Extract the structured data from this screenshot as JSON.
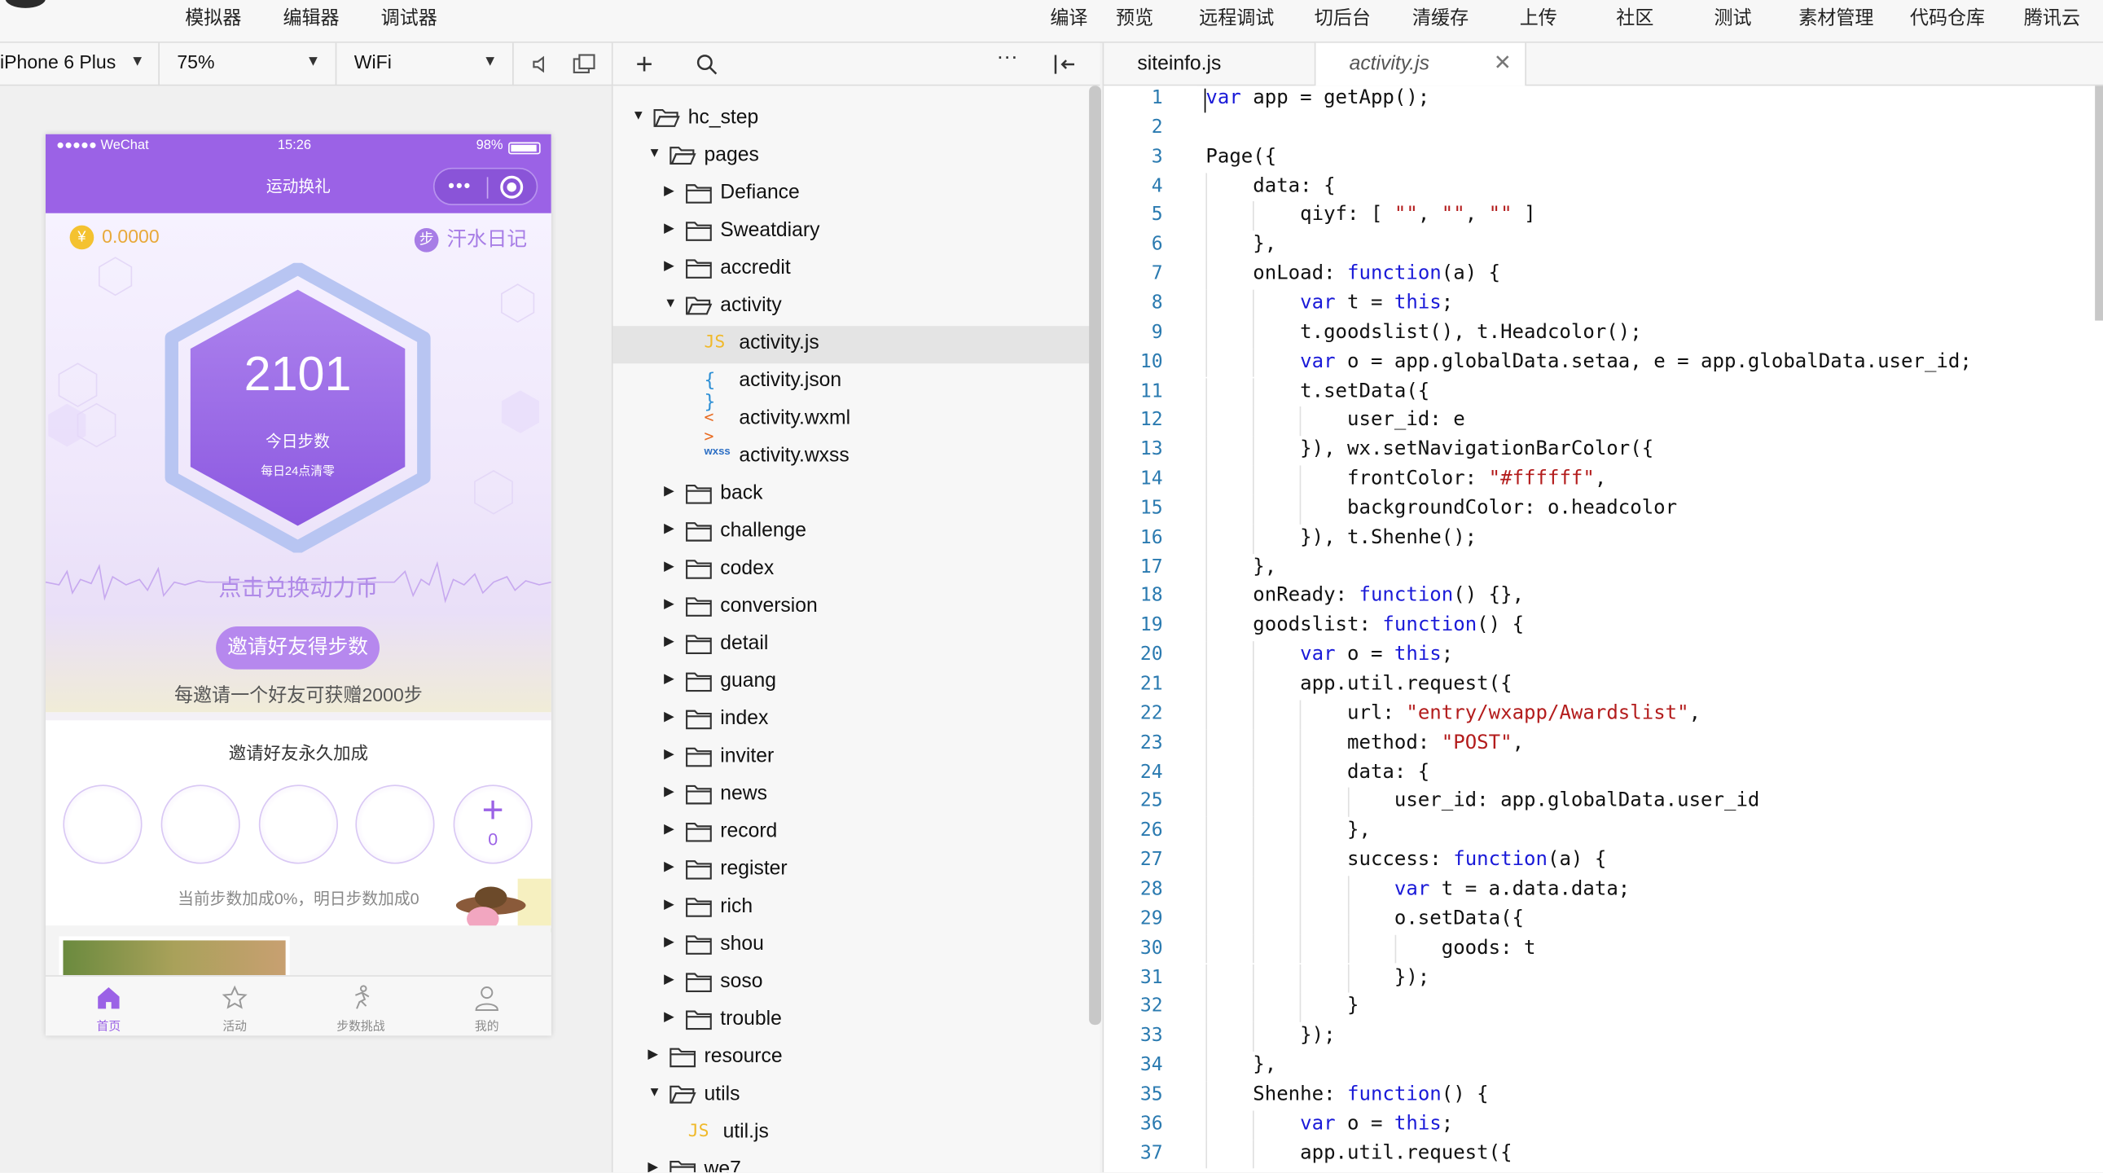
{
  "menu": {
    "left": [
      "模拟器",
      "编辑器",
      "调试器"
    ],
    "right": [
      "编译",
      "预览",
      "远程调试",
      "切后台",
      "清缓存",
      "上传",
      "社区",
      "测试",
      "素材管理",
      "代码仓库",
      "腾讯云"
    ]
  },
  "device": {
    "model": "iPhone 6 Plus",
    "zoom": "75%",
    "network": "WiFi"
  },
  "phone": {
    "carrier": "●●●●● WeChat",
    "time": "15:26",
    "battery": "98%",
    "nav_title": "运动换礼",
    "capsule_dots": "•••",
    "coin_symbol": "¥",
    "coin_value": "0.0000",
    "sweat_symbol": "步",
    "sweat_label": "汗水日记",
    "steps": "2101",
    "steps_label": "今日步数",
    "reset_note": "每日24点清零",
    "exchange": "点击兑换动力币",
    "invite_button": "邀请好友得步数",
    "invite_hint": "每邀请一个好友可获赠2000步",
    "bonus_title": "邀请好友永久加成",
    "add_symbol": "+",
    "invite_count": "0",
    "bonus_info": "当前步数加成0%，明日步数加成0",
    "tabs": [
      {
        "label": "首页",
        "icon": "home-icon"
      },
      {
        "label": "活动",
        "icon": "star-icon"
      },
      {
        "label": "步数挑战",
        "icon": "running-icon"
      },
      {
        "label": "我的",
        "icon": "user-icon"
      }
    ],
    "accent": "#9b62e6"
  },
  "tree": {
    "items": [
      {
        "name": "hc_step",
        "type": "folder",
        "open": true,
        "depth": 0
      },
      {
        "name": "pages",
        "type": "folder",
        "open": true,
        "depth": 1
      },
      {
        "name": "Defiance",
        "type": "folder",
        "open": false,
        "depth": 2
      },
      {
        "name": "Sweatdiary",
        "type": "folder",
        "open": false,
        "depth": 2
      },
      {
        "name": "accredit",
        "type": "folder",
        "open": false,
        "depth": 2
      },
      {
        "name": "activity",
        "type": "folder",
        "open": true,
        "depth": 2
      },
      {
        "name": "activity.js",
        "type": "js",
        "depth": 3,
        "selected": true
      },
      {
        "name": "activity.json",
        "type": "json",
        "depth": 3
      },
      {
        "name": "activity.wxml",
        "type": "wxml",
        "depth": 3
      },
      {
        "name": "activity.wxss",
        "type": "wxss",
        "depth": 3
      },
      {
        "name": "back",
        "type": "folder",
        "open": false,
        "depth": 2
      },
      {
        "name": "challenge",
        "type": "folder",
        "open": false,
        "depth": 2
      },
      {
        "name": "codex",
        "type": "folder",
        "open": false,
        "depth": 2
      },
      {
        "name": "conversion",
        "type": "folder",
        "open": false,
        "depth": 2
      },
      {
        "name": "detail",
        "type": "folder",
        "open": false,
        "depth": 2
      },
      {
        "name": "guang",
        "type": "folder",
        "open": false,
        "depth": 2
      },
      {
        "name": "index",
        "type": "folder",
        "open": false,
        "depth": 2
      },
      {
        "name": "inviter",
        "type": "folder",
        "open": false,
        "depth": 2
      },
      {
        "name": "news",
        "type": "folder",
        "open": false,
        "depth": 2
      },
      {
        "name": "record",
        "type": "folder",
        "open": false,
        "depth": 2
      },
      {
        "name": "register",
        "type": "folder",
        "open": false,
        "depth": 2
      },
      {
        "name": "rich",
        "type": "folder",
        "open": false,
        "depth": 2
      },
      {
        "name": "shou",
        "type": "folder",
        "open": false,
        "depth": 2
      },
      {
        "name": "soso",
        "type": "folder",
        "open": false,
        "depth": 2
      },
      {
        "name": "trouble",
        "type": "folder",
        "open": false,
        "depth": 2
      },
      {
        "name": "resource",
        "type": "folder",
        "open": false,
        "depth": 1
      },
      {
        "name": "utils",
        "type": "folder",
        "open": true,
        "depth": 1
      },
      {
        "name": "util.js",
        "type": "js",
        "depth": 2
      },
      {
        "name": "we7",
        "type": "folder",
        "open": false,
        "depth": 1
      }
    ]
  },
  "editor": {
    "tabs": [
      {
        "label": "siteinfo.js",
        "active": false
      },
      {
        "label": "activity.js",
        "active": true
      }
    ],
    "close_symbol": "✕",
    "lines": [
      [
        [
          "kw",
          "var"
        ],
        [
          "p",
          " app = getApp();"
        ]
      ],
      [],
      [
        [
          "p",
          "Page({"
        ]
      ],
      [
        [
          "p",
          "    data: {"
        ]
      ],
      [
        [
          "p",
          "        qiyf: [ "
        ],
        [
          "str",
          "\"\""
        ],
        [
          "p",
          ", "
        ],
        [
          "str",
          "\"\""
        ],
        [
          "p",
          ", "
        ],
        [
          "str",
          "\"\""
        ],
        [
          "p",
          " ]"
        ]
      ],
      [
        [
          "p",
          "    },"
        ]
      ],
      [
        [
          "p",
          "    onLoad: "
        ],
        [
          "kw",
          "function"
        ],
        [
          "p",
          "(a) {"
        ]
      ],
      [
        [
          "p",
          "        "
        ],
        [
          "kw",
          "var"
        ],
        [
          "p",
          " t = "
        ],
        [
          "kw",
          "this"
        ],
        [
          "p",
          ";"
        ]
      ],
      [
        [
          "p",
          "        t.goodslist(), t.Headcolor();"
        ]
      ],
      [
        [
          "p",
          "        "
        ],
        [
          "kw",
          "var"
        ],
        [
          "p",
          " o = app.globalData.setaa, e = app.globalData.user_id;"
        ]
      ],
      [
        [
          "p",
          "        t.setData({"
        ]
      ],
      [
        [
          "p",
          "            user_id: e"
        ]
      ],
      [
        [
          "p",
          "        }), wx.setNavigationBarColor({"
        ]
      ],
      [
        [
          "p",
          "            frontColor: "
        ],
        [
          "str",
          "\"#ffffff\""
        ],
        [
          "p",
          ","
        ]
      ],
      [
        [
          "p",
          "            backgroundColor: o.headcolor"
        ]
      ],
      [
        [
          "p",
          "        }), t.Shenhe();"
        ]
      ],
      [
        [
          "p",
          "    },"
        ]
      ],
      [
        [
          "p",
          "    onReady: "
        ],
        [
          "kw",
          "function"
        ],
        [
          "p",
          "() {},"
        ]
      ],
      [
        [
          "p",
          "    goodslist: "
        ],
        [
          "kw",
          "function"
        ],
        [
          "p",
          "() {"
        ]
      ],
      [
        [
          "p",
          "        "
        ],
        [
          "kw",
          "var"
        ],
        [
          "p",
          " o = "
        ],
        [
          "kw",
          "this"
        ],
        [
          "p",
          ";"
        ]
      ],
      [
        [
          "p",
          "        app.util.request({"
        ]
      ],
      [
        [
          "p",
          "            url: "
        ],
        [
          "str",
          "\"entry/wxapp/Awardslist\""
        ],
        [
          "p",
          ","
        ]
      ],
      [
        [
          "p",
          "            method: "
        ],
        [
          "str",
          "\"POST\""
        ],
        [
          "p",
          ","
        ]
      ],
      [
        [
          "p",
          "            data: {"
        ]
      ],
      [
        [
          "p",
          "                user_id: app.globalData.user_id"
        ]
      ],
      [
        [
          "p",
          "            },"
        ]
      ],
      [
        [
          "p",
          "            success: "
        ],
        [
          "kw",
          "function"
        ],
        [
          "p",
          "(a) {"
        ]
      ],
      [
        [
          "p",
          "                "
        ],
        [
          "kw",
          "var"
        ],
        [
          "p",
          " t = a.data.data;"
        ]
      ],
      [
        [
          "p",
          "                o.setData({"
        ]
      ],
      [
        [
          "p",
          "                    goods: t"
        ]
      ],
      [
        [
          "p",
          "                });"
        ]
      ],
      [
        [
          "p",
          "            }"
        ]
      ],
      [
        [
          "p",
          "        });"
        ]
      ],
      [
        [
          "p",
          "    },"
        ]
      ],
      [
        [
          "p",
          "    Shenhe: "
        ],
        [
          "kw",
          "function"
        ],
        [
          "p",
          "() {"
        ]
      ],
      [
        [
          "p",
          "        "
        ],
        [
          "kw",
          "var"
        ],
        [
          "p",
          " o = "
        ],
        [
          "kw",
          "this"
        ],
        [
          "p",
          ";"
        ]
      ],
      [
        [
          "p",
          "        app.util.request({"
        ]
      ]
    ]
  }
}
